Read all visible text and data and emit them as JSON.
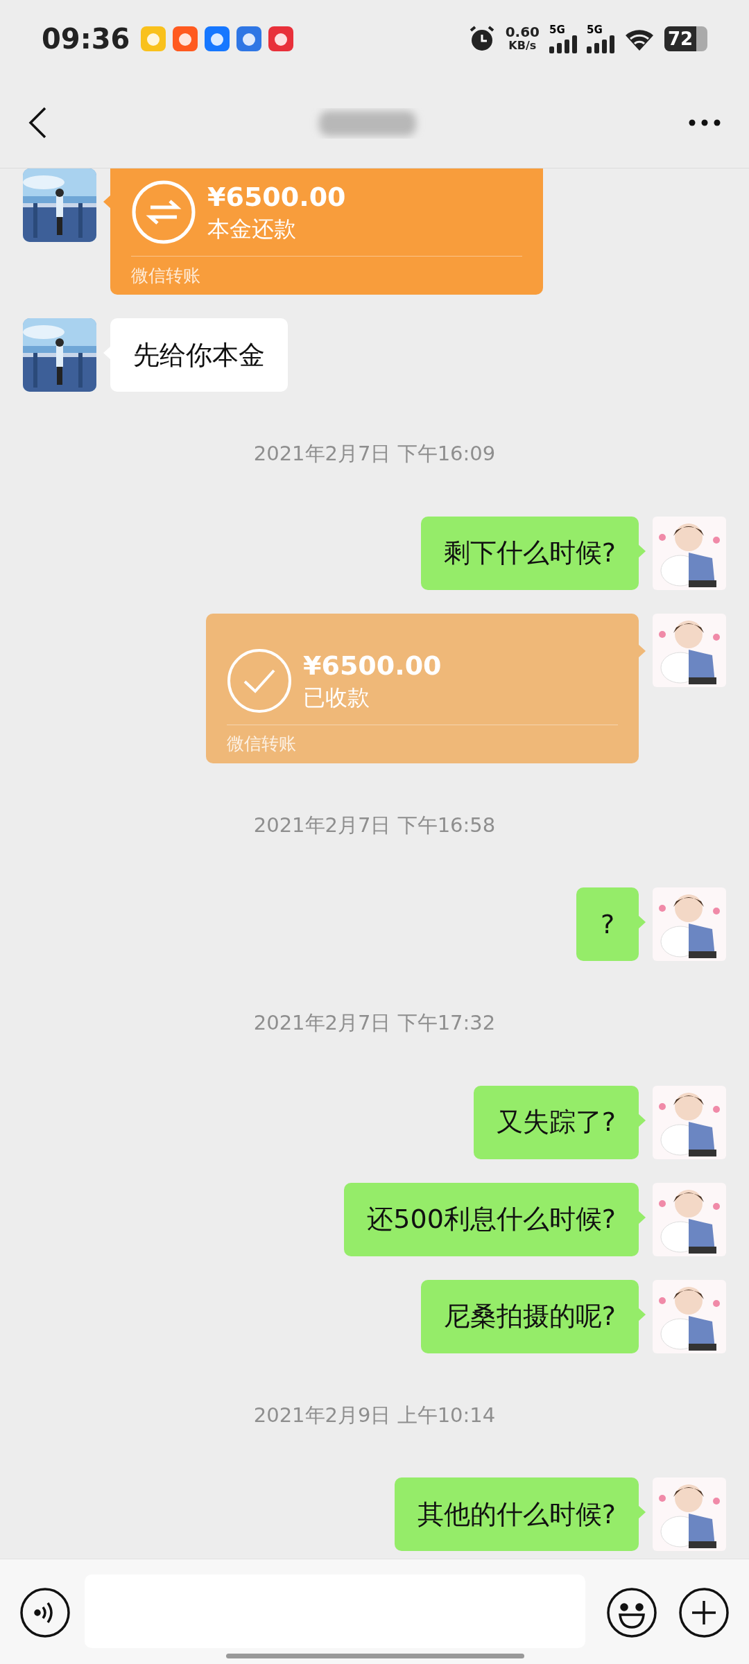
{
  "status_bar": {
    "time": "09:36",
    "net_speed": "0.60",
    "net_unit": "KB/s",
    "sim_1": "5G",
    "sim_2": "5G",
    "battery": "72"
  },
  "messages": [
    {
      "kind": "transfer",
      "outgoing": false,
      "received": false,
      "amount": "¥6500.00",
      "note": "本金还款",
      "footer": "微信转账",
      "cut_top": true
    },
    {
      "kind": "text",
      "outgoing": false,
      "text": "先给你本金"
    },
    {
      "kind": "time",
      "text": "2021年2月7日 下午16:09"
    },
    {
      "kind": "text",
      "outgoing": true,
      "text": "剩下什么时候?"
    },
    {
      "kind": "transfer",
      "outgoing": true,
      "received": true,
      "amount": "¥6500.00",
      "note": "已收款",
      "footer": "微信转账",
      "cut_top": false
    },
    {
      "kind": "time",
      "text": "2021年2月7日 下午16:58"
    },
    {
      "kind": "text",
      "outgoing": true,
      "text": "?"
    },
    {
      "kind": "time",
      "text": "2021年2月7日 下午17:32"
    },
    {
      "kind": "text",
      "outgoing": true,
      "text": "又失踪了?"
    },
    {
      "kind": "text",
      "outgoing": true,
      "text": "还500利息什么时候?"
    },
    {
      "kind": "text",
      "outgoing": true,
      "text": "尼桑拍摄的呢?"
    },
    {
      "kind": "time",
      "text": "2021年2月9日 上午10:14"
    },
    {
      "kind": "text",
      "outgoing": true,
      "text": "其他的什么时候?"
    }
  ]
}
